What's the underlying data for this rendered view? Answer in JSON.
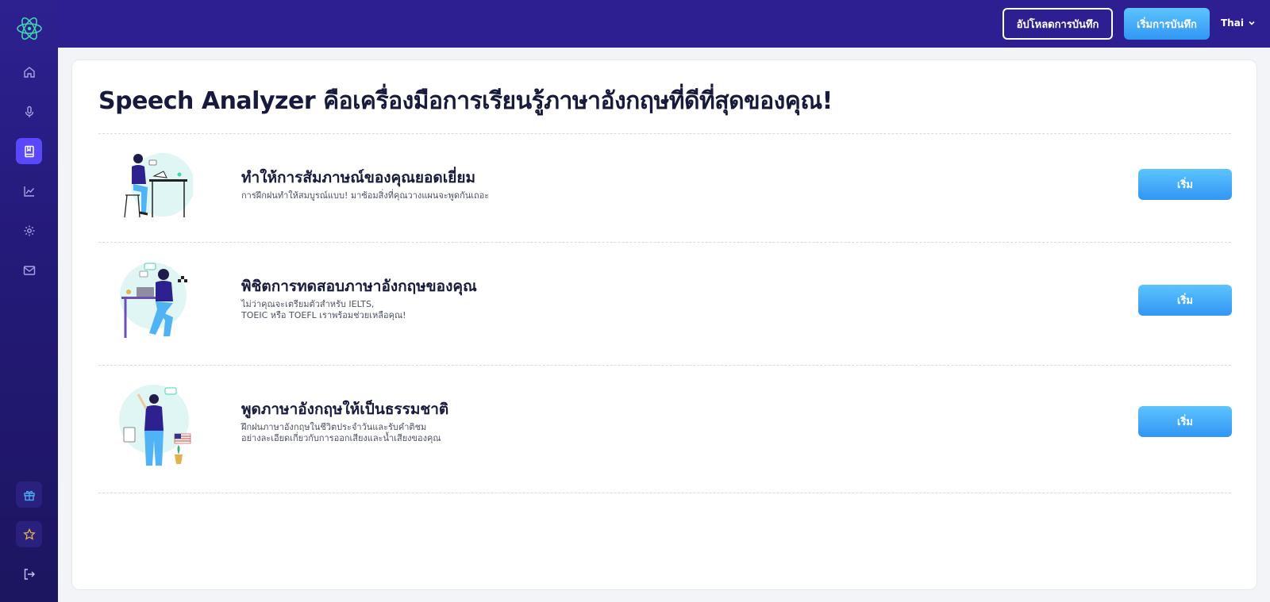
{
  "header": {
    "upload_label": "อัปโหลดการบันทึก",
    "record_label": "เริ่มการบันทึก",
    "language": "Thai"
  },
  "sidebar": {
    "items": [
      {
        "icon": "home-icon"
      },
      {
        "icon": "microphone-icon"
      },
      {
        "icon": "book-icon",
        "active": true
      },
      {
        "icon": "chart-icon"
      },
      {
        "icon": "gear-icon"
      },
      {
        "icon": "mail-icon"
      },
      {
        "icon": "gift-icon"
      },
      {
        "icon": "star-icon"
      },
      {
        "icon": "logout-icon"
      }
    ]
  },
  "main": {
    "title": "Speech Analyzer คือเครื่องมือการเรียนรู้ภาษาอังกฤษที่ดีที่สุดของคุณ!",
    "rows": [
      {
        "title": "ทำให้การสัมภาษณ์ของคุณยอดเยี่ยม",
        "desc_line1": "การฝึกฝนทำให้สมบูรณ์แบบ! มาซ้อมสิ่งที่คุณวางแผนจะพูดกันเถอะ",
        "desc_line2": "",
        "button": "เริ่ม"
      },
      {
        "title": "พิชิตการทดสอบภาษาอังกฤษของคุณ",
        "desc_line1": "ไม่ว่าคุณจะเตรียมตัวสำหรับ IELTS,",
        "desc_line2": "TOEIC หรือ TOEFL เราพร้อมช่วยเหลือคุณ!",
        "button": "เริ่ม"
      },
      {
        "title": "พูดภาษาอังกฤษให้เป็นธรรมชาติ",
        "desc_line1": "ฝึกฝนภาษาอังกฤษในชีวิตประจำวันและรับคำติชม",
        "desc_line2": "อย่างละเอียดเกี่ยวกับการออกเสียงและน้ำเสียงของคุณ",
        "button": "เริ่ม"
      }
    ]
  },
  "colors": {
    "sidebar": "#241a7a",
    "header": "#2d1f92",
    "accent": "#5a48ff",
    "button": "#3fa9f8"
  }
}
